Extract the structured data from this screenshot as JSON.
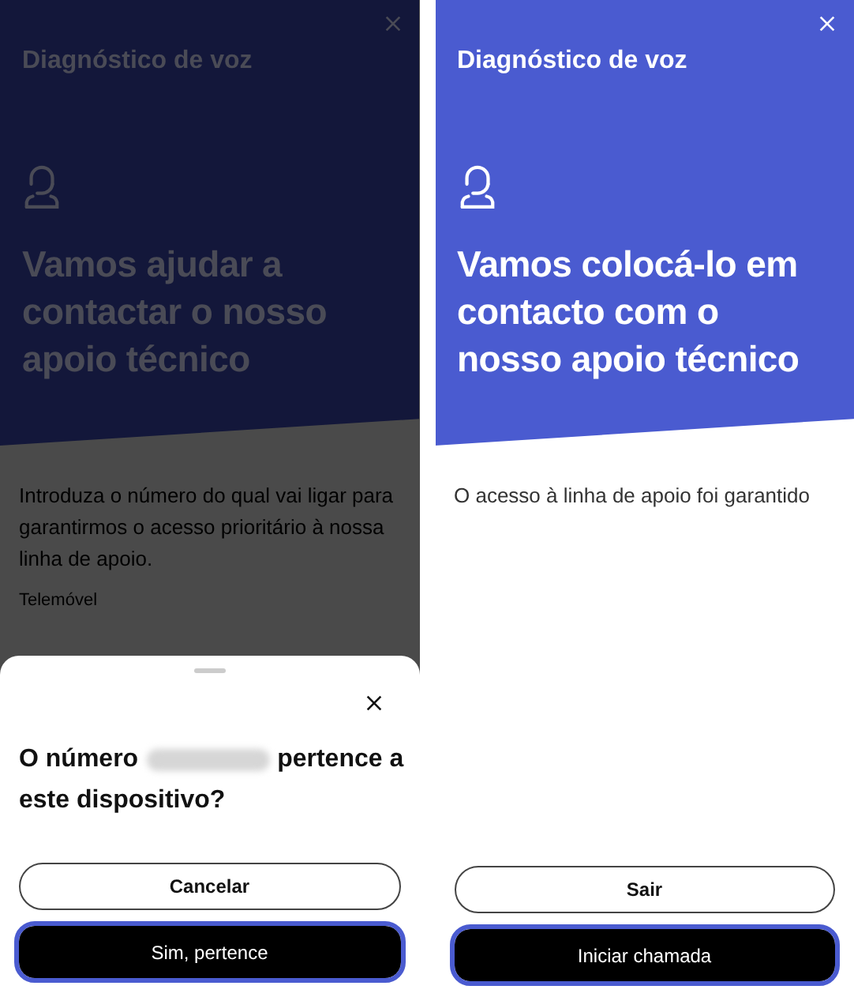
{
  "screens": [
    {
      "title": "Diagnóstico de voz",
      "headline": "Vamos ajudar a contactar o nosso apoio técnico",
      "body": "Introduza o número do qual vai ligar para garantirmos o acesso prioritário à nossa linha de apoio.",
      "field_label": "Telemóvel",
      "dimmed": true,
      "sheet": {
        "question_start": "O número",
        "number_redacted": true,
        "question_mid": "pertence a",
        "question_end": "este dispositivo?",
        "buttons": [
          {
            "label": "Cancelar",
            "kind": "outline",
            "focused": false
          },
          {
            "label": "Sim, pertence",
            "kind": "primary",
            "focused": true
          }
        ]
      }
    },
    {
      "title": "Diagnóstico de voz",
      "headline": "Vamos colocá-lo em contacto com o nosso apoio técnico",
      "body": "O acesso à linha de apoio foi garantido",
      "dimmed": false,
      "buttons": [
        {
          "label": "Sair",
          "kind": "outline",
          "focused": false
        },
        {
          "label": "Iniciar chamada",
          "kind": "primary",
          "focused": true
        }
      ]
    }
  ]
}
